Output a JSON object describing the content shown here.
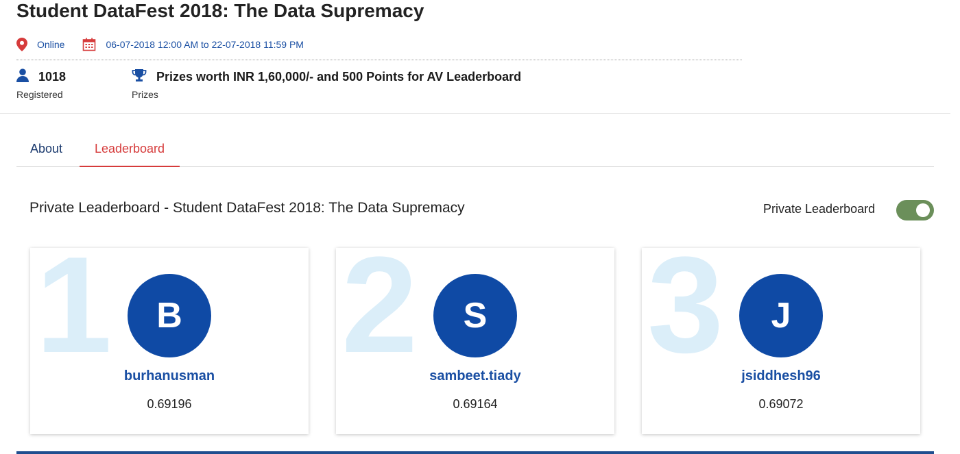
{
  "page": {
    "title": "Student DataFest 2018: The Data Supremacy"
  },
  "meta": {
    "location_icon": "map-pin-icon",
    "location": "Online",
    "calendar_icon": "calendar-icon",
    "dates": "06-07-2018 12:00 AM to 22-07-2018 11:59 PM"
  },
  "stats": {
    "registered": {
      "icon": "user-icon",
      "value": "1018",
      "label": "Registered"
    },
    "prizes": {
      "icon": "trophy-icon",
      "value": "Prizes worth INR 1,60,000/- and 500 Points for AV Leaderboard",
      "label": "Prizes"
    }
  },
  "tabs": [
    {
      "label": "About",
      "active": false
    },
    {
      "label": "Leaderboard",
      "active": true
    }
  ],
  "leaderboard": {
    "title": "Private Leaderboard - Student DataFest 2018: The Data Supremacy",
    "toggle_label": "Private Leaderboard",
    "toggle_on": true,
    "entries": [
      {
        "rank": "1",
        "initial": "B",
        "username": "burhanusman",
        "score": "0.69196"
      },
      {
        "rank": "2",
        "initial": "S",
        "username": "sambeet.tiady",
        "score": "0.69164"
      },
      {
        "rank": "3",
        "initial": "J",
        "username": "jsiddhesh96",
        "score": "0.69072"
      }
    ]
  },
  "colors": {
    "primary_blue": "#0f4aa5",
    "link_blue": "#1a4fa3",
    "accent_red": "#d63b3b",
    "rank_tint": "#dbeef9",
    "toggle_green": "#6b8f5a"
  }
}
